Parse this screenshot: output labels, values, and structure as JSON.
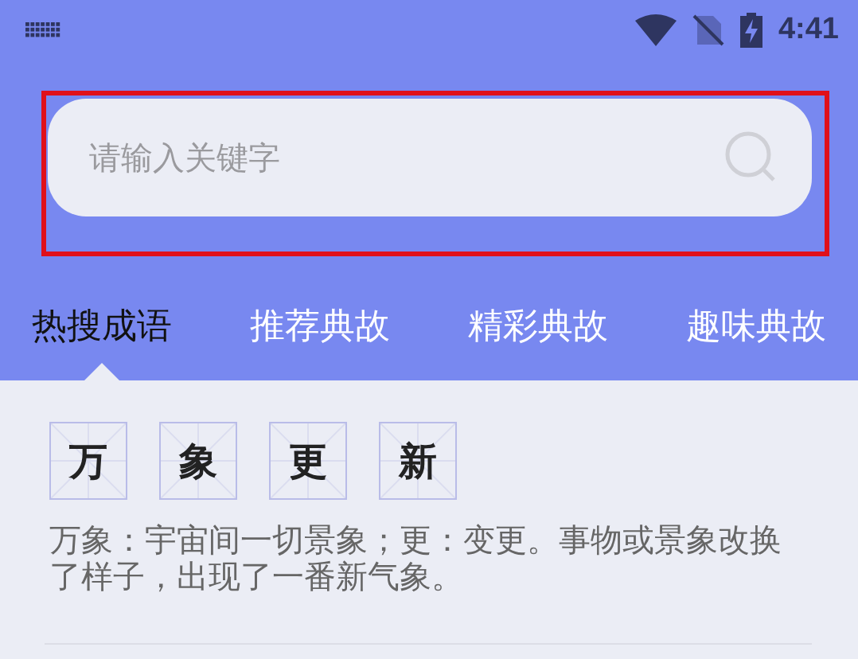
{
  "status_bar": {
    "time": "4:41"
  },
  "search": {
    "placeholder": "请输入关键字"
  },
  "tabs": [
    {
      "label": "热搜成语",
      "selected": true
    },
    {
      "label": "推荐典故",
      "selected": false
    },
    {
      "label": "精彩典故",
      "selected": false
    },
    {
      "label": "趣味典故",
      "selected": false
    }
  ],
  "idiom": {
    "characters": [
      "万",
      "象",
      "更",
      "新"
    ],
    "explanation": "万象：宇宙间一切景象；更：变更。事物或景象改换了样子，出现了一番新气象。"
  }
}
